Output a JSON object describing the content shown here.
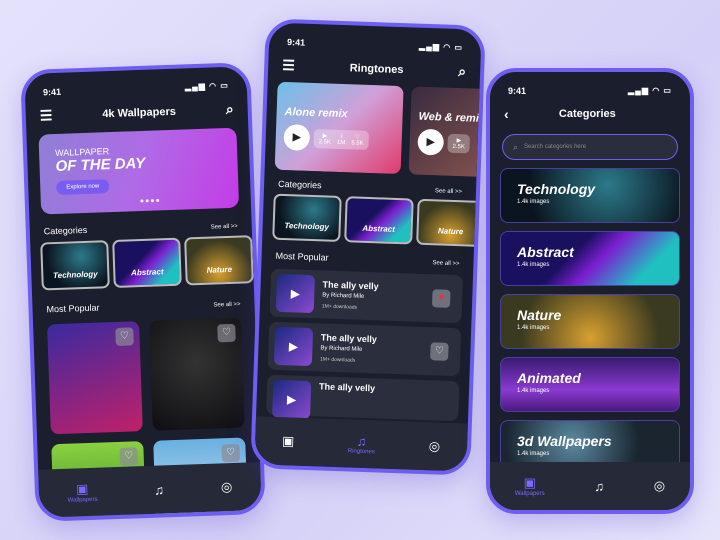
{
  "status_time": "9:41",
  "wallpapers": {
    "title": "4k Wallpapers",
    "banner": {
      "line1": "WALLPAPER",
      "line2": "OF THE DAY",
      "button": "Explore now",
      "dots": "●●●●"
    },
    "categories_label": "Categories",
    "see_all": "See all >>",
    "categories": [
      "Technology",
      "Abstract",
      "Nature"
    ],
    "popular_label": "Most Popular",
    "see_all2": "See all >>"
  },
  "ringtones": {
    "title": "Ringtones",
    "featured": [
      {
        "title": "Alone remix",
        "plays": "2.5K",
        "downloads": "1M",
        "likes": "5.5K"
      },
      {
        "title": "Web & remix",
        "plays": "2.5K"
      }
    ],
    "categories_label": "Categories",
    "see_all": "See all >>",
    "categories": [
      "Technology",
      "Abstract",
      "Nature"
    ],
    "popular_label": "Most Popular",
    "see_all2": "See all >>",
    "songs": [
      {
        "title": "The ally velly",
        "artist": "By Richard Mile",
        "downloads": "1M+ downloads",
        "liked": true
      },
      {
        "title": "The ally velly",
        "artist": "By Richard Mile",
        "downloads": "1M+ downloads",
        "liked": false
      },
      {
        "title": "The ally velly"
      }
    ]
  },
  "categories_screen": {
    "title": "Categories",
    "search_placeholder": "Search categories here",
    "items": [
      {
        "name": "Technology",
        "count": "1.4k images"
      },
      {
        "name": "Abstract",
        "count": "1.4k images"
      },
      {
        "name": "Nature",
        "count": "1.4k images"
      },
      {
        "name": "Animated",
        "count": "1.4k images"
      },
      {
        "name": "3d Wallpapers",
        "count": "1.4k images"
      }
    ]
  },
  "nav": {
    "wallpapers": "Wallpapers",
    "ringtones": "Ringtones"
  },
  "colors": {
    "accent": "#6e5ff2",
    "screen": "#1b1e2c",
    "liked": "#e8323c"
  }
}
